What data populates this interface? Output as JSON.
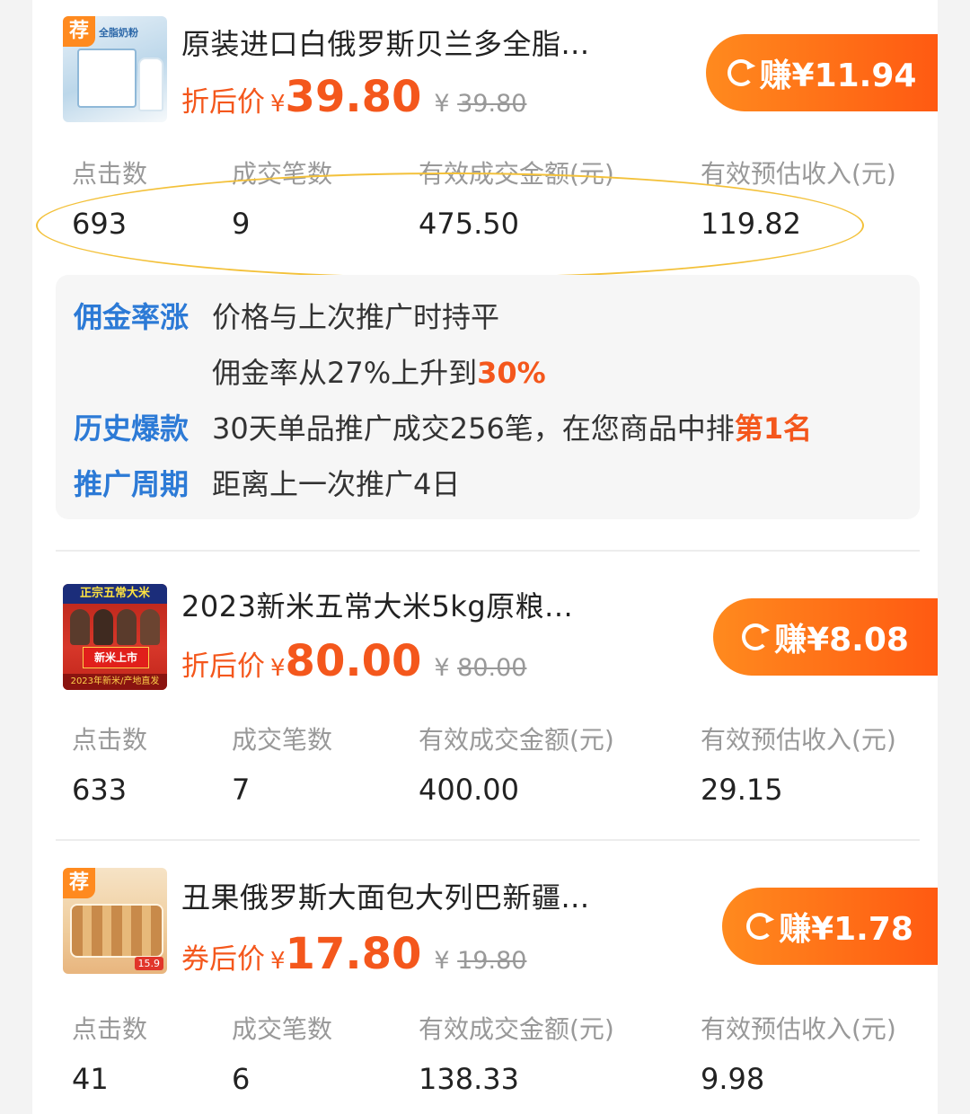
{
  "stat_labels": {
    "clicks": "点击数",
    "deals": "成交笔数",
    "amount": "有效成交金额(元)",
    "income": "有效预估收入(元)"
  },
  "products": [
    {
      "rec_tag": "荐",
      "thumb_text": "全脂奶粉",
      "title": "原装进口白俄罗斯贝兰多全脂...",
      "price_label": "折后价",
      "price_currency": "¥",
      "price": "39.80",
      "orig_currency": "¥",
      "orig_price": "39.80",
      "earn_label": "赚¥11.94",
      "stats": {
        "clicks": "693",
        "deals": "9",
        "amount": "475.50",
        "income": "119.82"
      }
    },
    {
      "rec_tag": "",
      "thumb_banner": "正宗五常大米",
      "thumb_label": "新米上市",
      "thumb_foot": "2023年新米/产地直发",
      "title": "2023新米五常大米5kg原粮...",
      "price_label": "折后价",
      "price_currency": "¥",
      "price": "80.00",
      "orig_currency": "¥",
      "orig_price": "80.00",
      "earn_label": "赚¥8.08",
      "stats": {
        "clicks": "633",
        "deals": "7",
        "amount": "400.00",
        "income": "29.15"
      }
    },
    {
      "rec_tag": "荐",
      "thumb_price": "15.9",
      "title": "丑果俄罗斯大面包大列巴新疆...",
      "price_label": "券后价",
      "price_currency": "¥",
      "price": "17.80",
      "orig_currency": "¥",
      "orig_price": "19.80",
      "earn_label": "赚¥1.78",
      "stats": {
        "clicks": "41",
        "deals": "6",
        "amount": "138.33",
        "income": "9.98"
      }
    }
  ],
  "insights": {
    "commission": {
      "key": "佣金率涨",
      "line1": "价格与上次推广时持平",
      "line2_prefix": "佣金率从27%上升到",
      "line2_highlight": "30%"
    },
    "history": {
      "key": "历史爆款",
      "text_prefix": "30天单品推广成交256笔，在您商品中排",
      "highlight": "第1名"
    },
    "cycle": {
      "key": "推广周期",
      "text": "距离上一次推广4日"
    }
  },
  "colors": {
    "accent": "#f4571c",
    "link_blue": "#2c7ad6",
    "earn_gradient_start": "#ff8a1e",
    "earn_gradient_end": "#ff5a12",
    "highlight_ellipse": "#f3c13a"
  }
}
